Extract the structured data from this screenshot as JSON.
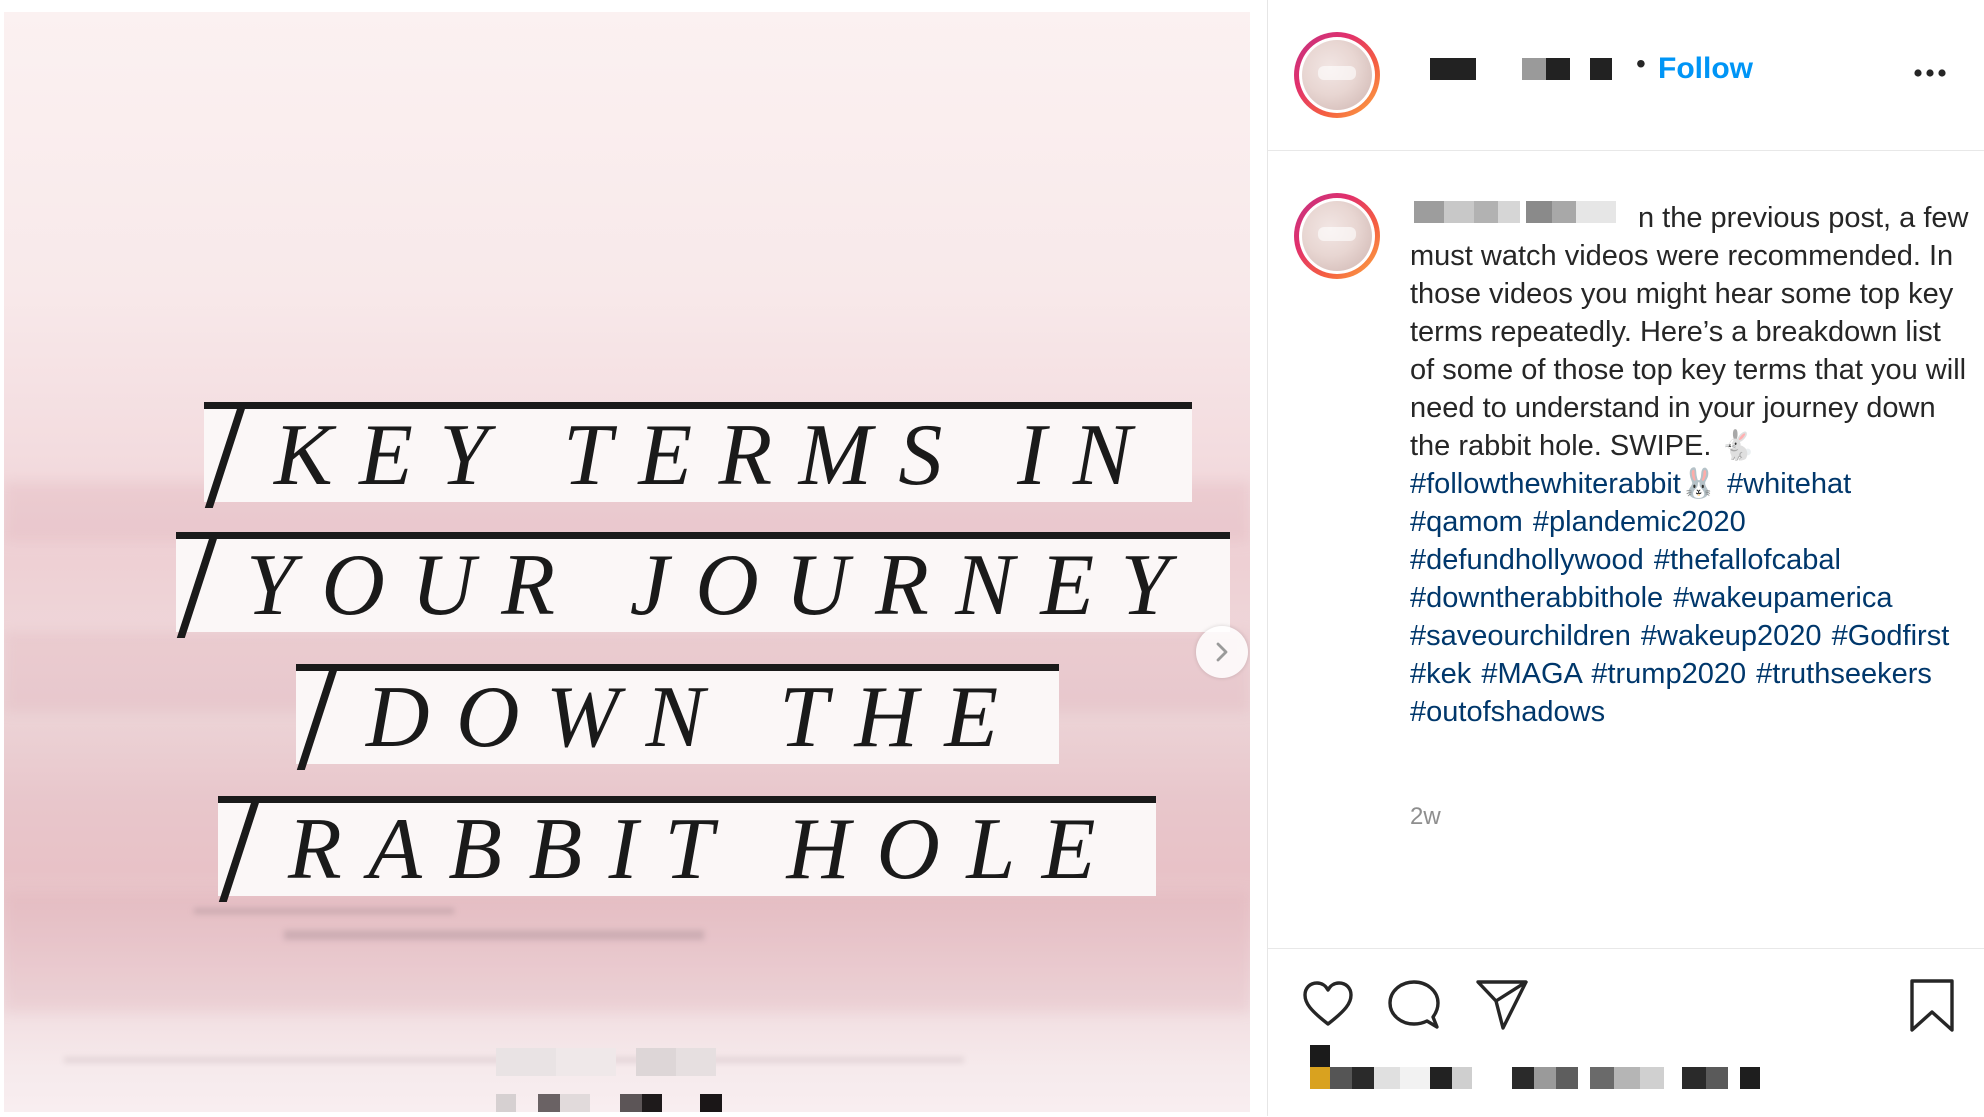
{
  "media": {
    "overlay_lines": [
      "KEY TERMS IN",
      "YOUR JOURNEY",
      "DOWN THE",
      "RABBIT HOLE"
    ],
    "next_icon": "chevron-right-icon"
  },
  "header": {
    "separator": "•",
    "follow_label": "Follow",
    "more_icon": "more-options-icon"
  },
  "caption": {
    "text": "n the previous post, a few must watch videos were recommended. In those videos you might hear some top key terms repeatedly. Here’s a breakdown list of some of those top key terms that you will need to understand in your journey down the rabbit hole. SWIPE. 🐇",
    "hashtags": [
      "#followthewhiterabbit🐰",
      "#whitehat",
      "#qamom",
      "#plandemic2020",
      "#defundhollywood",
      "#thefallofcabal",
      "#downtherabbithole",
      "#wakeupamerica",
      "#saveourchildren",
      "#wakeup2020",
      "#Godfirst",
      "#kek",
      "#MAGA",
      "#trump2020",
      "#truthseekers",
      "#outofshadows"
    ],
    "timestamp": "2w"
  },
  "actions": {
    "like_icon": "heart-icon",
    "comment_icon": "comment-icon",
    "share_icon": "paper-plane-icon",
    "save_icon": "bookmark-icon"
  },
  "colors": {
    "link_blue": "#0095f6",
    "hashtag_blue": "#00376b",
    "text": "#262626",
    "muted": "#8e8e8e"
  }
}
